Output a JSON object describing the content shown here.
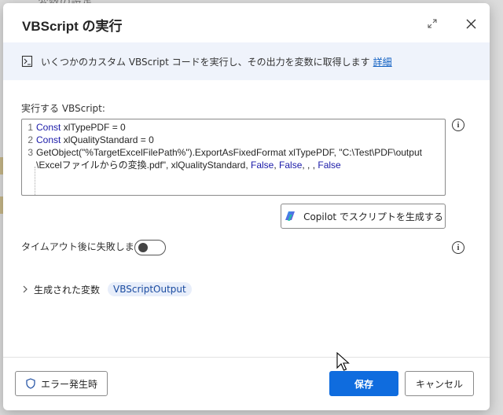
{
  "background": {
    "title": "変数の設定"
  },
  "dialog": {
    "title": "VBScript の実行"
  },
  "info": {
    "text": "いくつかのカスタム VBScript コードを実行し、その出力を変数に取得します",
    "link": "詳細"
  },
  "script": {
    "label": "実行する VBScript:",
    "lines": [
      {
        "num": "1",
        "kw": "Const",
        "text": " xlTypePDF = 0"
      },
      {
        "num": "2",
        "kw": "Const",
        "text": " xlQualityStandard = 0"
      },
      {
        "num": "3",
        "text": "GetObject(\"%TargetExcelFilePath%\").ExportAsFixedFormat xlTypePDF, \"C:\\Test\\PDF\\output"
      }
    ],
    "line4": {
      "text": "\\Excelファイルからの変換.pdf\", xlQualityStandard, ",
      "kw1": "False",
      "sep1": ", ",
      "kw2": "False",
      "sep2": ", , , ",
      "kw3": "False"
    }
  },
  "copilot": {
    "label": "Copilot でスクリプトを生成する"
  },
  "timeout": {
    "label": "タイムアウト後に失敗します:",
    "enabled": false
  },
  "variables": {
    "label": "生成された変数",
    "chip": "VBScriptOutput"
  },
  "footer": {
    "error_label": "エラー発生時",
    "save_label": "保存",
    "cancel_label": "キャンセル"
  },
  "colors": {
    "primary": "#0f6cde",
    "keyword": "#1a1aa8",
    "info_bg": "#eff3fb",
    "chip_bg": "#e8eefa"
  }
}
